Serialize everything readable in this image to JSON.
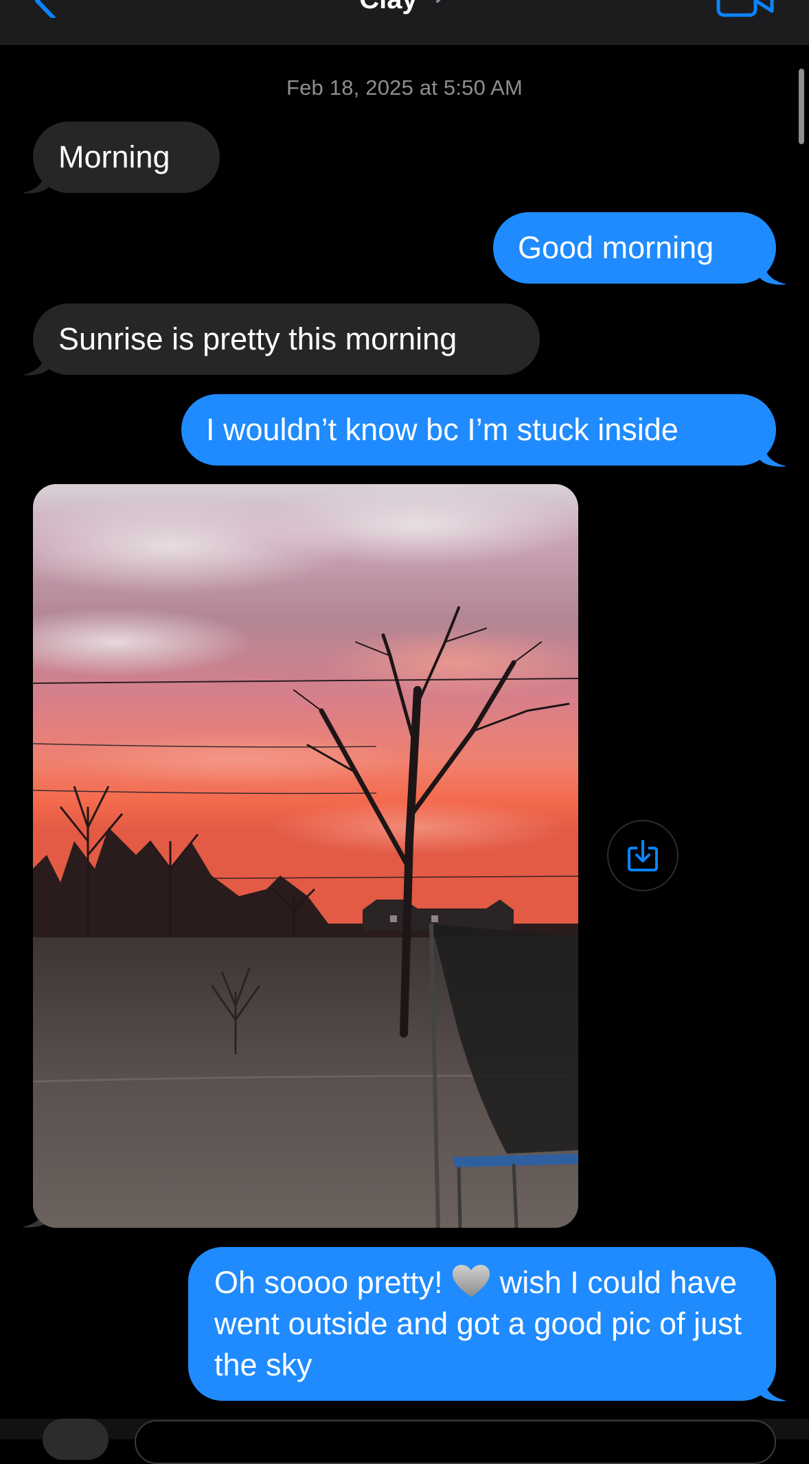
{
  "nav": {
    "title": "Clay",
    "back_icon": "chevron-left-icon",
    "video_icon": "video-camera-icon"
  },
  "thread": {
    "timestamp": "Feb 18, 2025 at 5:50 AM",
    "messages": [
      {
        "direction": "incoming",
        "text": "Morning"
      },
      {
        "direction": "outgoing",
        "text": "Good morning"
      },
      {
        "direction": "incoming",
        "text": "Sunrise is pretty this morning"
      },
      {
        "direction": "outgoing",
        "text": "I wouldn’t know bc I’m stuck inside"
      },
      {
        "direction": "incoming",
        "type": "photo"
      },
      {
        "direction": "outgoing",
        "text_before_emoji": "Oh soooo pretty! ",
        "emoji": "grey-heart",
        "text_after_emoji": " wish I could have went outside and got a good pic of just the sky"
      }
    ]
  },
  "colors": {
    "background": "#000000",
    "incoming_bubble": "#262628",
    "outgoing_bubble": "#1f8bff",
    "accent": "#0a84ff",
    "timestamp": "#8e8e93"
  },
  "save_button": {
    "icon": "save-to-photos-icon"
  }
}
